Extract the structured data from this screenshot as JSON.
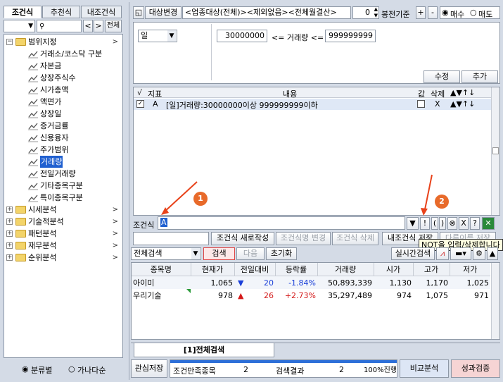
{
  "left": {
    "tabs": [
      "조건식",
      "추천식",
      "내조건식"
    ],
    "search_placeholder": "",
    "all_button": "전체",
    "tree": [
      {
        "label": "범위지정",
        "expanded": true,
        "children": [
          "거래소/코스닥 구분",
          "자본금",
          "상장주식수",
          "시가총액",
          "액면가",
          "상장일",
          "증거금률",
          "신용융자",
          "주가범위",
          "거래량",
          "전일거래량",
          "기타종목구분",
          "특이종목구분"
        ],
        "selected_child": "거래량"
      },
      {
        "label": "시세분석",
        "expanded": false
      },
      {
        "label": "기술적분석",
        "expanded": false
      },
      {
        "label": "패턴분석",
        "expanded": false
      },
      {
        "label": "재무분석",
        "expanded": false
      },
      {
        "label": "순위분석",
        "expanded": false
      }
    ],
    "sort_options": [
      "분류별",
      "가나다순"
    ],
    "sort_selected": "분류별"
  },
  "top": {
    "target_change_label": "대상변경",
    "target_text": "<업종대상(전체)><제외없음><전체월결산>",
    "stepper_value": "0",
    "base_label": "봉전기준",
    "plus": "+",
    "minus": "-",
    "buy_label": "매수",
    "sell_label": "매도",
    "trade_selected": "매수"
  },
  "param": {
    "period_value": "일",
    "min_value": "30000000",
    "range_label": "<= 거래량 <=",
    "max_value": "999999999",
    "edit_button": "수정",
    "add_button": "추가"
  },
  "cond_table": {
    "headers": [
      "√",
      "지표",
      "내용",
      "값",
      "삭제",
      "▲▼↑↓"
    ],
    "rows": [
      {
        "checked": true,
        "indicator": "A",
        "content": "[일]거래량:30000000이상 999999999이하",
        "value": "",
        "delete": "X",
        "moves": "▲▼↑↓"
      }
    ]
  },
  "condition": {
    "label": "조건식",
    "value": "A",
    "buttons": [
      "▼",
      "!",
      "(",
      ")",
      "⊗",
      "X",
      "?"
    ]
  },
  "actions": {
    "new_button": "조건식 새로작성",
    "rename_button": "조건식명 변경",
    "delete_button": "조건식 삭제",
    "save_button": "내조건식 저장",
    "save_as_button": "다른이름 저장",
    "tooltip": "NOT을 입력/삭제합니다"
  },
  "search_bar": {
    "scope_value": "전체검색",
    "search_button": "검색",
    "next_button": "다음",
    "reset_button": "초기화",
    "realtime_button": "실시간검색"
  },
  "annotations": [
    "1",
    "2"
  ],
  "results": {
    "headers": [
      "종목명",
      "현재가",
      "전일대비",
      "등락률",
      "거래량",
      "시가",
      "고가",
      "저가"
    ],
    "rows": [
      {
        "name": "아이미",
        "price": "1,065",
        "dir": "down",
        "change": "20",
        "rate": "-1.84%",
        "volume": "50,893,339",
        "open": "1,130",
        "high": "1,170",
        "low": "1,025"
      },
      {
        "name": "우리기술",
        "price": "978",
        "dir": "up",
        "change": "26",
        "rate": "+2.73%",
        "volume": "35,297,489",
        "open": "974",
        "high": "1,075",
        "low": "971"
      }
    ],
    "bottom_tab": "[1]전체검색"
  },
  "footer": {
    "interest_save": "관심저장",
    "match_label": "조건만족종목",
    "match_count": "2",
    "result_label": "검색결과",
    "result_count": "2",
    "progress_label": "100%진행",
    "progress": 1.0,
    "compare_button": "비교분석",
    "verify_button": "성과검증"
  },
  "colors": {
    "down": "#1a3fd8",
    "up": "#d41a1a",
    "selected_tree": "#2060d0",
    "accent_orange": "#e86a2a"
  }
}
